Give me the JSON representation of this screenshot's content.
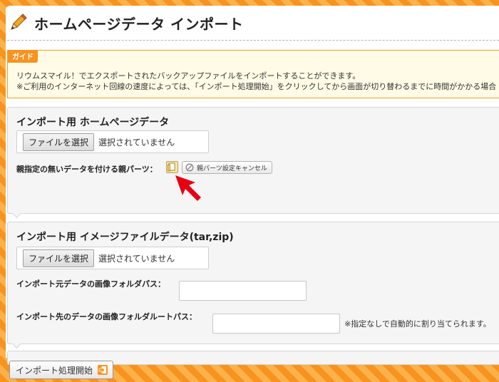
{
  "header": {
    "title": "ホームページデータ インポート",
    "icon": "pencil-icon"
  },
  "guide": {
    "tag": "ガイド",
    "line1": "リウムスマイル！でエクスポートされたバックアップファイルをインポートすることができます。",
    "line2": "※ご利用のインターネット回線の速度によっては、「インポート処理開始」をクリックしてから画面が切り替わるまでに時間がかかる場合（数"
  },
  "homepage_section": {
    "title": "インポート用 ホームページデータ",
    "file_button": "ファイルを選択",
    "file_status": "選択されていません",
    "parent_parts_label": "親指定の無いデータを付ける親パーツ：",
    "parent_parts_icon": "folder-page-icon",
    "cancel_button": "親パーツ設定キャンセル",
    "cancel_icon": "prohibited-icon"
  },
  "image_section": {
    "title": "インポート用 イメージファイルデータ(tar,zip)",
    "file_button": "ファイルを選択",
    "file_status": "選択されていません",
    "source_path_label": "インポート元データの画像フォルダパス：",
    "source_path_value": "",
    "dest_path_label": "インポート先のデータの画像フォルダルートパス：",
    "dest_path_value": "",
    "dest_path_hint": "※指定なしで自動的に割り当てられます。"
  },
  "footer": {
    "start_button": "インポート処理開始",
    "start_icon": "import-arrow-icon"
  },
  "colors": {
    "accent": "#f7931e",
    "arrow": "#e60012",
    "guide_bg": "#fffbe6"
  }
}
